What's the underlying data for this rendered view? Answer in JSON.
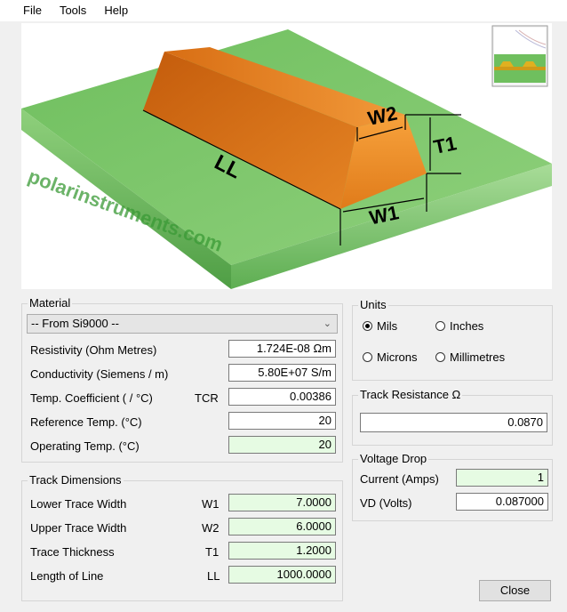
{
  "menu": [
    "File",
    "Tools",
    "Help"
  ],
  "illustration": {
    "labels": {
      "w2": "W2",
      "t1": "T1",
      "ll": "LL",
      "w1": "W1"
    },
    "watermark": "polarinstruments.com"
  },
  "material": {
    "title": "Material",
    "selected": "-- From Si9000 --",
    "resistivity_label": "Resistivity (Ohm Metres)",
    "resistivity_value": "1.724E-08 Ωm",
    "conductivity_label": "Conductivity (Siemens / m)",
    "conductivity_value": "5.80E+07 S/m",
    "tc_label": "Temp. Coefficient ( / °C)",
    "tc_abbrev": "TCR",
    "tc_value": "0.00386",
    "ref_temp_label": "Reference Temp. (°C)",
    "ref_temp_value": "20",
    "op_temp_label": "Operating Temp. (°C)",
    "op_temp_value": "20"
  },
  "units": {
    "title": "Units",
    "options": [
      "Mils",
      "Inches",
      "Microns",
      "Millimetres"
    ],
    "selected": "Mils"
  },
  "track_resistance": {
    "title": "Track Resistance Ω",
    "value": "0.0870"
  },
  "track_dimensions": {
    "title": "Track Dimensions",
    "rows": [
      {
        "label": "Lower Trace Width",
        "abbrev": "W1",
        "value": "7.0000"
      },
      {
        "label": "Upper Trace Width",
        "abbrev": "W2",
        "value": "6.0000"
      },
      {
        "label": "Trace Thickness",
        "abbrev": "T1",
        "value": "1.2000"
      },
      {
        "label": "Length of Line",
        "abbrev": "LL",
        "value": "1000.0000"
      }
    ]
  },
  "voltage_drop": {
    "title": "Voltage Drop",
    "current_label": "Current (Amps)",
    "current_value": "1",
    "vd_label": "VD (Volts)",
    "vd_value": "0.087000"
  },
  "close_label": "Close",
  "colors": {
    "board_green": "#7cc66b",
    "trace_orange": "#e07b1a",
    "field_green": "#e6fbe3"
  }
}
